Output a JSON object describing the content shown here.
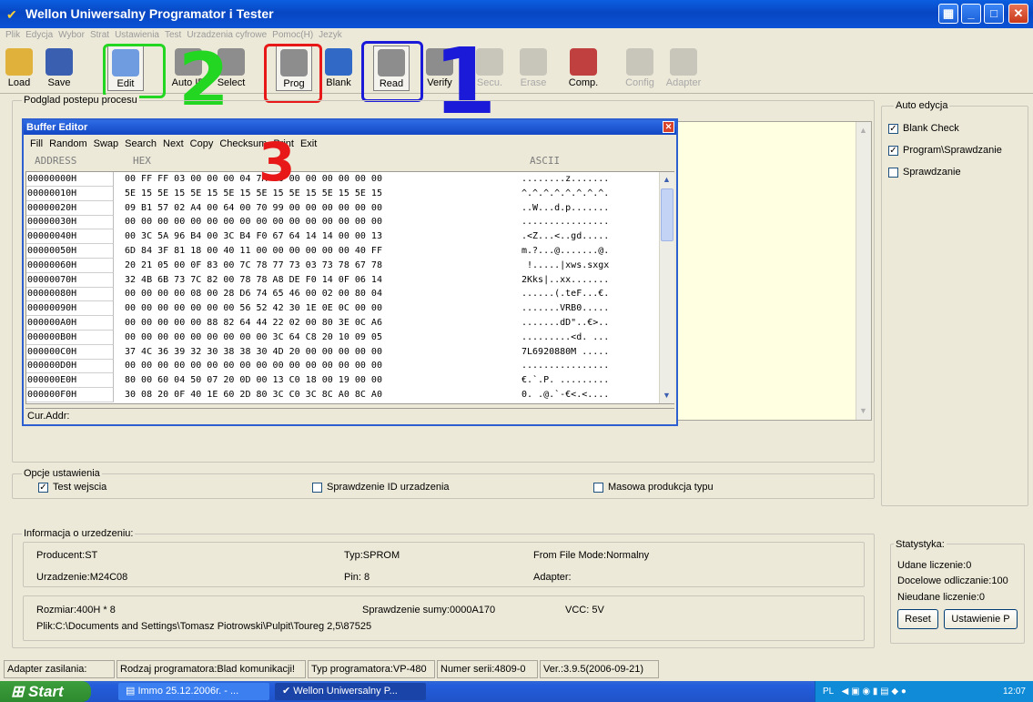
{
  "window": {
    "title": "Wellon Uniwersalny Programator i Tester",
    "buttons": [
      "▦",
      "_",
      "□",
      "✕"
    ]
  },
  "menu": [
    "Plik",
    "Edycja",
    "Wybor",
    "Strat",
    "Ustawienia",
    "Test",
    "Urzadzenia cyfrowe",
    "Pomoc(H)",
    "Jezyk"
  ],
  "toolbar": {
    "buttons": [
      {
        "label": "Load",
        "icon": "folder-open-icon",
        "color": "#e0b23c"
      },
      {
        "label": "Save",
        "icon": "floppy-icon",
        "color": "#3b5fb0"
      },
      {
        "label": "Edit",
        "icon": "edit-icon",
        "color": "#6f9be0"
      },
      {
        "label": "Auto ID",
        "icon": "chip-icon",
        "color": "#8d8d8d"
      },
      {
        "label": "Select",
        "icon": "chip-select-icon",
        "color": "#8d8d8d"
      },
      {
        "label": "Prog",
        "icon": "chip-prog-icon",
        "color": "#8d8d8d"
      },
      {
        "label": "Blank",
        "icon": "help-icon",
        "color": "#3169c6"
      },
      {
        "label": "Read",
        "icon": "chip-read-icon",
        "color": "#8d8d8d"
      },
      {
        "label": "Verify",
        "icon": "chip-verify-icon",
        "color": "#8d8d8d"
      },
      {
        "label": "Secu.",
        "icon": "lock-icon",
        "color": "#bdbdbd"
      },
      {
        "label": "Erase",
        "icon": "eraser-icon",
        "color": "#bdbdbd"
      },
      {
        "label": "Comp.",
        "icon": "compare-icon",
        "color": "#c04040"
      },
      {
        "label": "Config",
        "icon": "config-icon",
        "color": "#bdbdbd"
      },
      {
        "label": "Adapter",
        "icon": "adapter-icon",
        "color": "#bdbdbd"
      }
    ],
    "annotations": {
      "n1": "1",
      "n2": "2",
      "n3": "3"
    },
    "annotation_colors": {
      "edit": "#22d622",
      "prog": "#e81818",
      "read": "#1a1ad8"
    }
  },
  "progress_group": {
    "label": "Podglad postepu procesu"
  },
  "auto_edit": {
    "label": "Auto edycja",
    "items": [
      {
        "label": "Blank Check",
        "checked": true
      },
      {
        "label": "Program\\Sprawdzanie",
        "checked": true
      },
      {
        "label": "Sprawdzanie",
        "checked": false
      }
    ]
  },
  "buffer_editor": {
    "title": "Buffer Editor",
    "close": "✕",
    "menu": [
      "Fill",
      "Random",
      "Swap",
      "Search",
      "Next",
      "Copy",
      "Checksum",
      "Print",
      "Exit"
    ],
    "headers": {
      "address": "ADDRESS",
      "hex": "HEX",
      "ascii": "ASCII"
    },
    "rows": [
      {
        "addr": "00000000H",
        "hex": "00 FF FF 03 00 00 00 04 7A B6 00 00 00 00 00 00",
        "ascii": "........z......."
      },
      {
        "addr": "00000010H",
        "hex": "5E 15 5E 15 5E 15 5E 15 5E 15 5E 15 5E 15 5E 15",
        "ascii": "^.^.^.^.^.^.^.^."
      },
      {
        "addr": "00000020H",
        "hex": "09 B1 57 02 A4 00 64 00 70 99 00 00 00 00 00 00",
        "ascii": "..W...d.p......."
      },
      {
        "addr": "00000030H",
        "hex": "00 00 00 00 00 00 00 00 00 00 00 00 00 00 00 00",
        "ascii": "................"
      },
      {
        "addr": "00000040H",
        "hex": "00 3C 5A 96 B4 00 3C B4 F0 67 64 14 14 00 00 13",
        "ascii": ".<Z...<..gd....."
      },
      {
        "addr": "00000050H",
        "hex": "6D 84 3F 81 18 00 40 11 00 00 00 00 00 00 40 FF",
        "ascii": "m.?...@.......@."
      },
      {
        "addr": "00000060H",
        "hex": "20 21 05 00 0F 83 00 7C 78 77 73 03 73 78 67 78",
        "ascii": " !.....|xws.sxgx"
      },
      {
        "addr": "00000070H",
        "hex": "32 4B 6B 73 7C 82 00 78 78 A8 DE F0 14 0F 06 14",
        "ascii": "2Kks|..xx......."
      },
      {
        "addr": "00000080H",
        "hex": "00 00 00 00 08 00 28 D6 74 65 46 00 02 00 80 04",
        "ascii": "......(.teF...€."
      },
      {
        "addr": "00000090H",
        "hex": "00 00 00 00 00 00 00 56 52 42 30 1E 0E 0C 00 00",
        "ascii": ".......VRB0....."
      },
      {
        "addr": "000000A0H",
        "hex": "00 00 00 00 00 88 82 64 44 22 02 00 80 3E 0C A6",
        "ascii": ".......dD\"..€>.."
      },
      {
        "addr": "000000B0H",
        "hex": "00 00 00 00 00 00 00 00 00 3C 64 C8 20 10 09 05",
        "ascii": ".........<d. ..."
      },
      {
        "addr": "000000C0H",
        "hex": "37 4C 36 39 32 30 38 38 30 4D 20 00 00 00 00 00",
        "ascii": "7L6920880M ....."
      },
      {
        "addr": "000000D0H",
        "hex": "00 00 00 00 00 00 00 00 00 00 00 00 00 00 00 00",
        "ascii": "................"
      },
      {
        "addr": "000000E0H",
        "hex": "80 00 60 04 50 07 20 0D 00 13 C0 18 00 19 00 00",
        "ascii": "€.`.P. ........."
      },
      {
        "addr": "000000F0H",
        "hex": "30 08 20 0F 40 1E 60 2D 80 3C C0 3C 8C A0 8C A0",
        "ascii": "0. .@.`-€<.<...."
      }
    ],
    "status_label": "Cur.Addr:"
  },
  "options": {
    "label": "Opcje ustawienia",
    "items": [
      {
        "label": "Test wejscia",
        "checked": true
      },
      {
        "label": "Sprawdzenie ID urzadzenia",
        "checked": false
      },
      {
        "label": "Masowa produkcja typu",
        "checked": false
      }
    ]
  },
  "device_info": {
    "label": "Informacja o urzedzeniu:",
    "producent": "Producent:ST",
    "typ": "Typ:SPROM",
    "file_mode": "From File Mode:Normalny",
    "urzadzenie": "Urzadzenie:M24C08",
    "pin": "Pin: 8",
    "adapter": "Adapter:",
    "rozmiar": "Rozmiar:400H * 8",
    "checksum": "Sprawdzenie sumy:0000A170",
    "vcc": "VCC: 5V",
    "plik": "Plik:C:\\Documents and Settings\\Tomasz Piotrowski\\Pulpit\\Toureg 2,5\\87525"
  },
  "stats": {
    "label": "Statystyka:",
    "udane": "Udane liczenie:0",
    "docelowe": "Docelowe odliczanie:100",
    "nieudane": "Nieudane liczenie:0",
    "reset": "Reset",
    "ustawienie": "Ustawienie P"
  },
  "statusbar": [
    "Adapter zasilania:",
    "Rodzaj programatora:Blad komunikacji!",
    "Typ programatora:VP-480",
    "Numer serii:4809-0",
    "Ver.:3.9.5(2006-09-21)"
  ],
  "taskbar": {
    "start": "Start",
    "tasks": [
      "Immo 25.12.2006r. - ...",
      "Wellon Uniwersalny P..."
    ],
    "lang": "PL",
    "clock": "12:07"
  }
}
